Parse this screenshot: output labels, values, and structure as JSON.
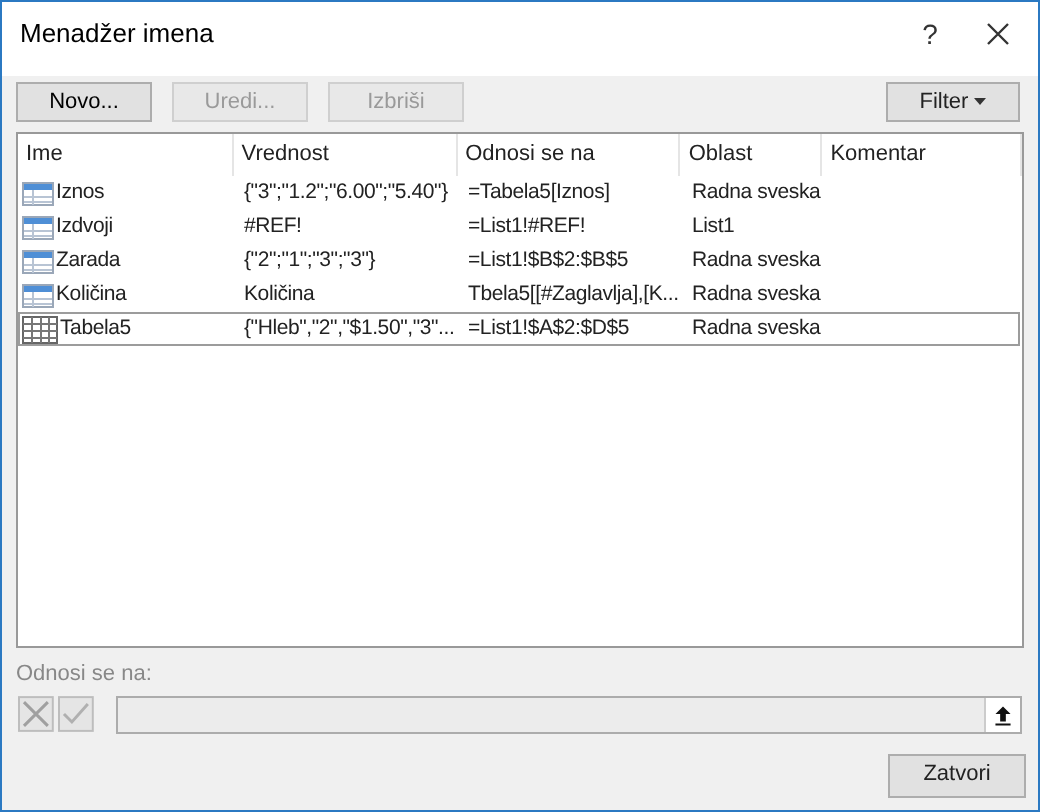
{
  "window": {
    "title": "Menadžer imena",
    "help": "?"
  },
  "buttons": [
    {
      "label": "Novo...",
      "disabled": false
    },
    {
      "label": "Uredi...",
      "disabled": true
    },
    {
      "label": "Izbriši",
      "disabled": true
    }
  ],
  "filter": {
    "label": "Filter"
  },
  "table": {
    "columns": [
      "Ime",
      "Vrednost",
      "Odnosi se na",
      "Oblast",
      "Komentar"
    ],
    "rows": [
      {
        "kind": "name",
        "selected": false,
        "cells": [
          "Iznos",
          "{\"3\";\"1.2\";\"6.00\";\"5.40\"}",
          "=Tabela5[Iznos]",
          "Radna sveska"
        ]
      },
      {
        "kind": "name",
        "selected": false,
        "cells": [
          "Izdvoji",
          "#REF!",
          "=List1!#REF!",
          "List1"
        ]
      },
      {
        "kind": "name",
        "selected": false,
        "cells": [
          "Zarada",
          "{\"2\";\"1\";\"3\";\"3\"}",
          "=List1!$B$2:$B$5",
          "Radna sveska"
        ]
      },
      {
        "kind": "name",
        "selected": false,
        "cells": [
          "Količina",
          "Količina",
          "Tbela5[[#Zaglavlja],[K...",
          "Radna sveska"
        ]
      },
      {
        "kind": "table",
        "selected": true,
        "cells": [
          "Tabela5",
          "{\"Hleb\",\"2\",\"$1.50\",\"3\"...",
          "=List1!$A$2:$D$5",
          "Radna sveska"
        ]
      }
    ]
  },
  "refers_to": {
    "label": "Odnosi se na:"
  },
  "close_button": {
    "label": "Zatvori"
  }
}
